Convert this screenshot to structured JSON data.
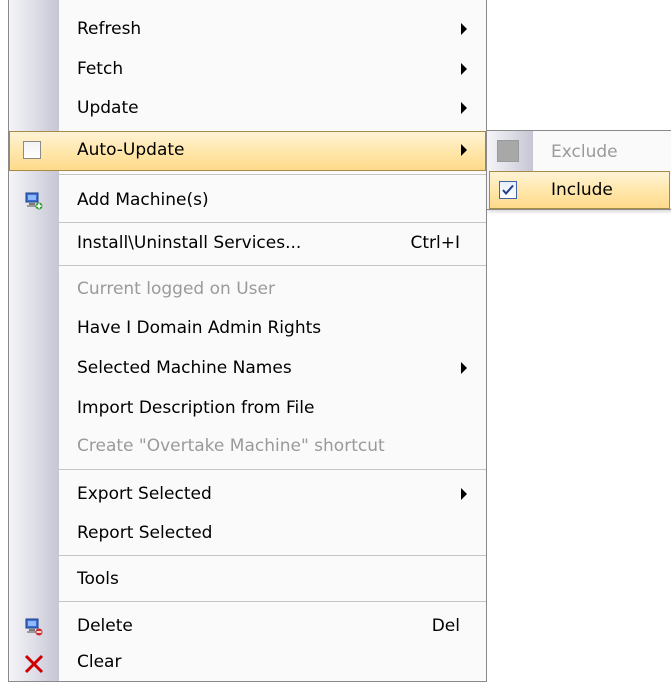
{
  "menu": {
    "items": [
      {
        "id": "refresh",
        "label": "Refresh",
        "has_submenu": true
      },
      {
        "id": "fetch",
        "label": "Fetch",
        "has_submenu": true
      },
      {
        "id": "update",
        "label": "Update",
        "has_submenu": true
      },
      {
        "id": "auto_update",
        "label": "Auto-Update",
        "has_submenu": true,
        "checked": false,
        "highlighted": true
      },
      {
        "id": "add_machine",
        "label": "Add Machine(s)",
        "icon": "add-machine-icon"
      },
      {
        "id": "install_uninstall",
        "label": "Install\\Uninstall Services...",
        "shortcut": "Ctrl+I"
      },
      {
        "id": "current_user",
        "label": "Current logged on User",
        "disabled": true
      },
      {
        "id": "domain_admin",
        "label": "Have I Domain Admin Rights"
      },
      {
        "id": "selected_names",
        "label": "Selected Machine Names",
        "has_submenu": true
      },
      {
        "id": "import_desc",
        "label": "Import Description from File"
      },
      {
        "id": "create_shortcut",
        "label": "Create \"Overtake Machine\" shortcut",
        "disabled": true
      },
      {
        "id": "export_selected",
        "label": "Export Selected",
        "has_submenu": true
      },
      {
        "id": "report_selected",
        "label": "Report Selected"
      },
      {
        "id": "tools",
        "label": "Tools"
      },
      {
        "id": "delete",
        "label": "Delete",
        "shortcut": "Del",
        "icon": "delete-machine-icon"
      },
      {
        "id": "clear",
        "label": "Clear",
        "icon": "red-x-icon"
      }
    ]
  },
  "submenu": {
    "items": [
      {
        "id": "exclude",
        "label": "Exclude",
        "disabled": true
      },
      {
        "id": "include",
        "label": "Include",
        "checked": true,
        "highlighted": true
      }
    ]
  },
  "colors": {
    "highlight": "#ffe6a8",
    "highlight_border": "#a78a45",
    "disabled_text": "#9a9a9a",
    "delete_icon": "#cc0000"
  }
}
